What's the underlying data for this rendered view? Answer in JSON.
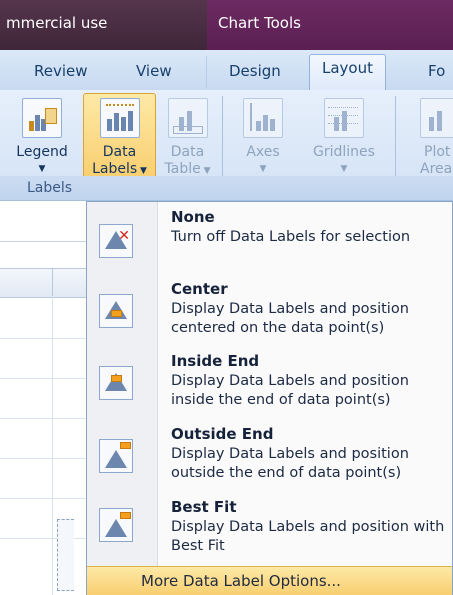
{
  "titlebar": {
    "app_title": "mmercial use",
    "contextual_tab": "Chart Tools"
  },
  "tabs": [
    {
      "label": "Review"
    },
    {
      "label": "View"
    },
    {
      "label": "Design"
    },
    {
      "label": "Layout",
      "active": true
    },
    {
      "label": "Fo"
    }
  ],
  "ribbon": {
    "buttons": [
      {
        "label": "Legend",
        "icon": "legend-icon",
        "enabled": true
      },
      {
        "label_line1": "Data",
        "label_line2": "Labels",
        "icon": "data-labels-icon",
        "enabled": true,
        "pressed": true
      },
      {
        "label_line1": "Data",
        "label_line2": "Table",
        "icon": "data-table-icon",
        "enabled": false
      },
      {
        "label": "Axes",
        "icon": "axes-icon",
        "enabled": false
      },
      {
        "label": "Gridlines",
        "icon": "gridlines-icon",
        "enabled": false
      },
      {
        "label_line1": "Plot",
        "label_line2": "Area",
        "icon": "plot-area-icon",
        "enabled": false
      }
    ],
    "group_label": "Labels"
  },
  "menu": {
    "items": [
      {
        "title": "None",
        "description": "Turn off Data Labels for selection",
        "icon": "data-labels-none-icon"
      },
      {
        "title": "Center",
        "description": "Display Data Labels and position centered on the data point(s)",
        "icon": "data-labels-center-icon"
      },
      {
        "title": "Inside End",
        "description": "Display Data Labels and position inside the end of data point(s)",
        "icon": "data-labels-inside-end-icon"
      },
      {
        "title": "Outside End",
        "description": "Display Data Labels and position outside the end of data point(s)",
        "icon": "data-labels-outside-end-icon"
      },
      {
        "title": "Best Fit",
        "description": "Display Data Labels and position with Best Fit",
        "icon": "data-labels-best-fit-icon"
      }
    ],
    "more_options": "More Data Label Options..."
  },
  "colors": {
    "title_bar": "#4a2f44",
    "chart_tools_tab": "#6c2b62",
    "ribbon_bg": "#dbe8f7",
    "highlight": "#f8c862",
    "menu_bg": "#fafafa"
  }
}
